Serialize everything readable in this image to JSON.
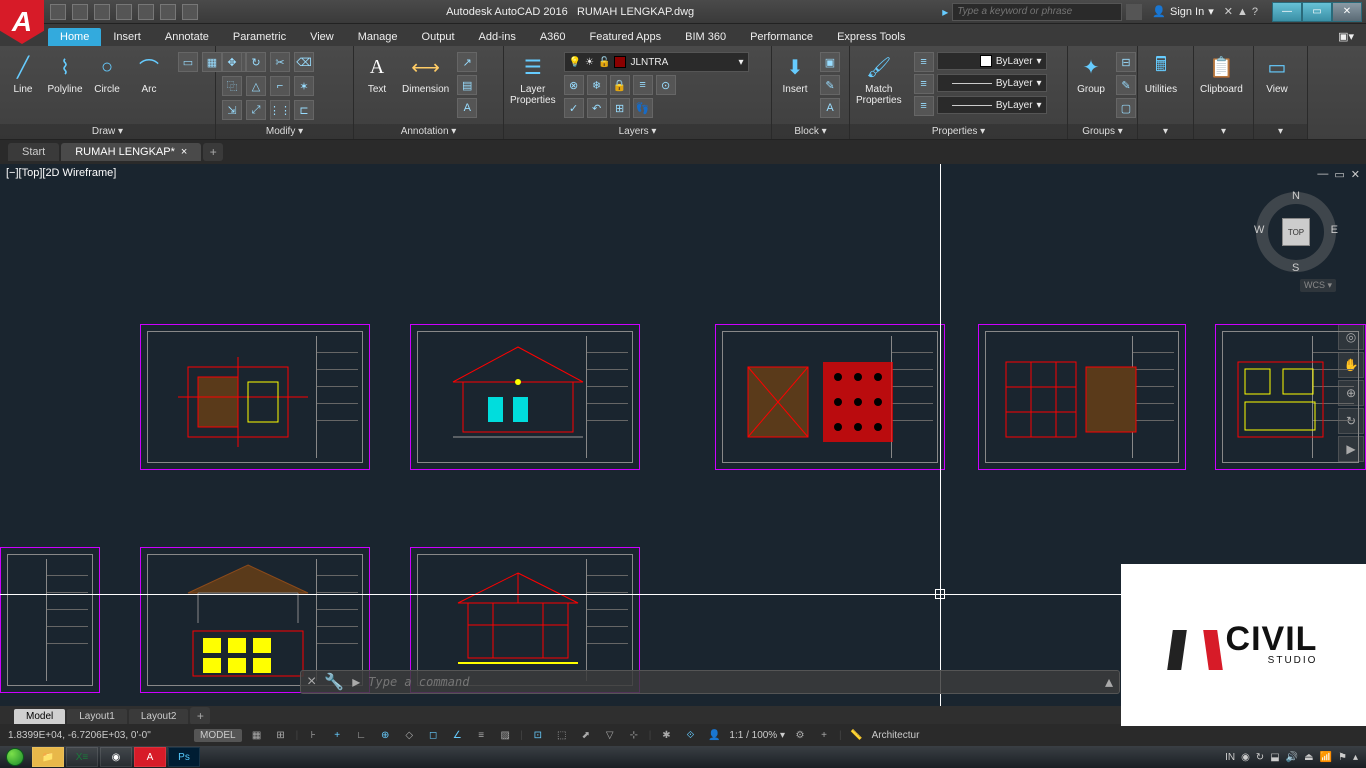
{
  "title": {
    "app": "Autodesk AutoCAD 2016",
    "file": "RUMAH LENGKAP.dwg"
  },
  "search_placeholder": "Type a keyword or phrase",
  "signin": "Sign In",
  "ribbon_tabs": [
    "Home",
    "Insert",
    "Annotate",
    "Parametric",
    "View",
    "Manage",
    "Output",
    "Add-ins",
    "A360",
    "Featured Apps",
    "BIM 360",
    "Performance",
    "Express Tools"
  ],
  "panels": {
    "draw": {
      "title": "Draw ▾",
      "line": "Line",
      "polyline": "Polyline",
      "circle": "Circle",
      "arc": "Arc"
    },
    "modify": {
      "title": "Modify ▾"
    },
    "annotation": {
      "title": "Annotation ▾",
      "text": "Text",
      "dimension": "Dimension"
    },
    "layers": {
      "title": "Layers ▾",
      "props": "Layer\nProperties",
      "current": "JLNTRA"
    },
    "block": {
      "title": "Block ▾",
      "insert": "Insert"
    },
    "properties": {
      "title": "Properties ▾",
      "match": "Match\nProperties",
      "color": "ByLayer",
      "lw": "ByLayer",
      "lt": "ByLayer"
    },
    "groups": {
      "title": "Groups ▾",
      "group": "Group"
    },
    "utilities": {
      "title": "Utilities"
    },
    "clipboard": {
      "title": "Clipboard"
    },
    "view": {
      "title": "View"
    }
  },
  "file_tabs": {
    "start": "Start",
    "doc": "RUMAH LENGKAP*"
  },
  "viewport_label": "[−][Top][2D Wireframe]",
  "viewcube": {
    "face": "TOP",
    "n": "N",
    "s": "S",
    "e": "E",
    "w": "W",
    "wcs": "WCS ▾"
  },
  "cmd_placeholder": "Type a command",
  "layout_tabs": [
    "Model",
    "Layout1",
    "Layout2"
  ],
  "status": {
    "coords": "1.8399E+04, -6.7206E+03, 0'-0\"",
    "space": "MODEL",
    "scale": "1:1 / 100% ▾",
    "ws": "Architectur"
  },
  "taskbar": {
    "lang": "IN"
  },
  "watermark": {
    "brand": "CIVIL",
    "sub": "STUDIO"
  }
}
